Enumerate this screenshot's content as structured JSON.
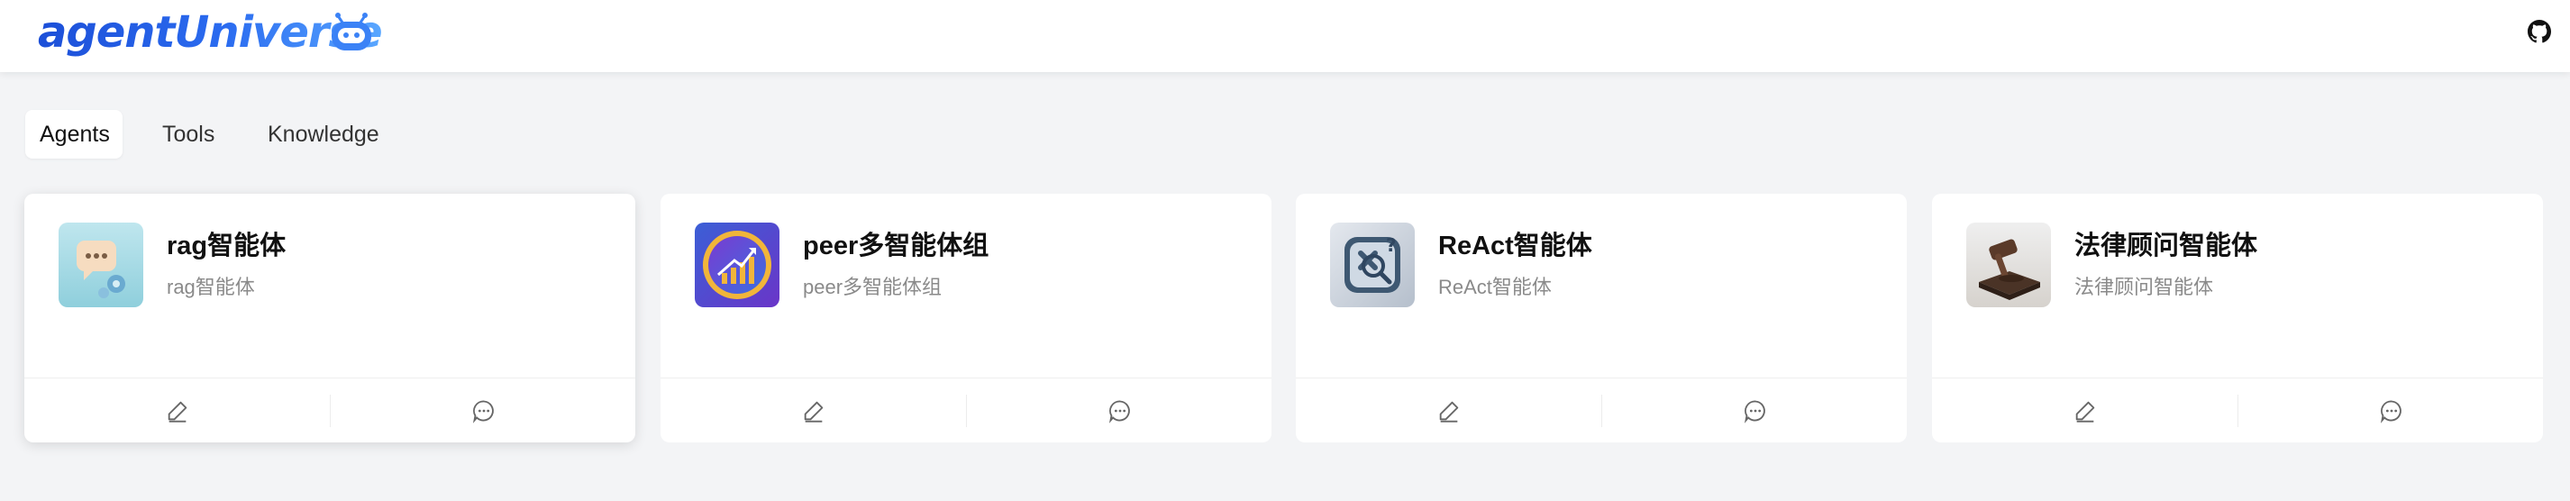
{
  "header": {
    "logo_text": "agentUniverse",
    "logo_icon": "robot-icon",
    "github_icon": "github-icon"
  },
  "tabs": [
    {
      "label": "Agents",
      "active": true
    },
    {
      "label": "Tools",
      "active": false
    },
    {
      "label": "Knowledge",
      "active": false
    }
  ],
  "agents": [
    {
      "name": "rag智能体",
      "description": "rag智能体",
      "avatar_icon": "chat-bubble-icon"
    },
    {
      "name": "peer多智能体组",
      "description": "peer多智能体组",
      "avatar_icon": "growth-chart-icon"
    },
    {
      "name": "ReAct智能体",
      "description": "ReAct智能体",
      "avatar_icon": "question-search-icon"
    },
    {
      "name": "法律顾问智能体",
      "description": "法律顾问智能体",
      "avatar_icon": "gavel-icon"
    }
  ],
  "card_actions": {
    "edit_icon": "edit-icon",
    "chat_icon": "chat-icon"
  },
  "colors": {
    "brand": "#2b6cf0",
    "background": "#f3f4f6"
  }
}
